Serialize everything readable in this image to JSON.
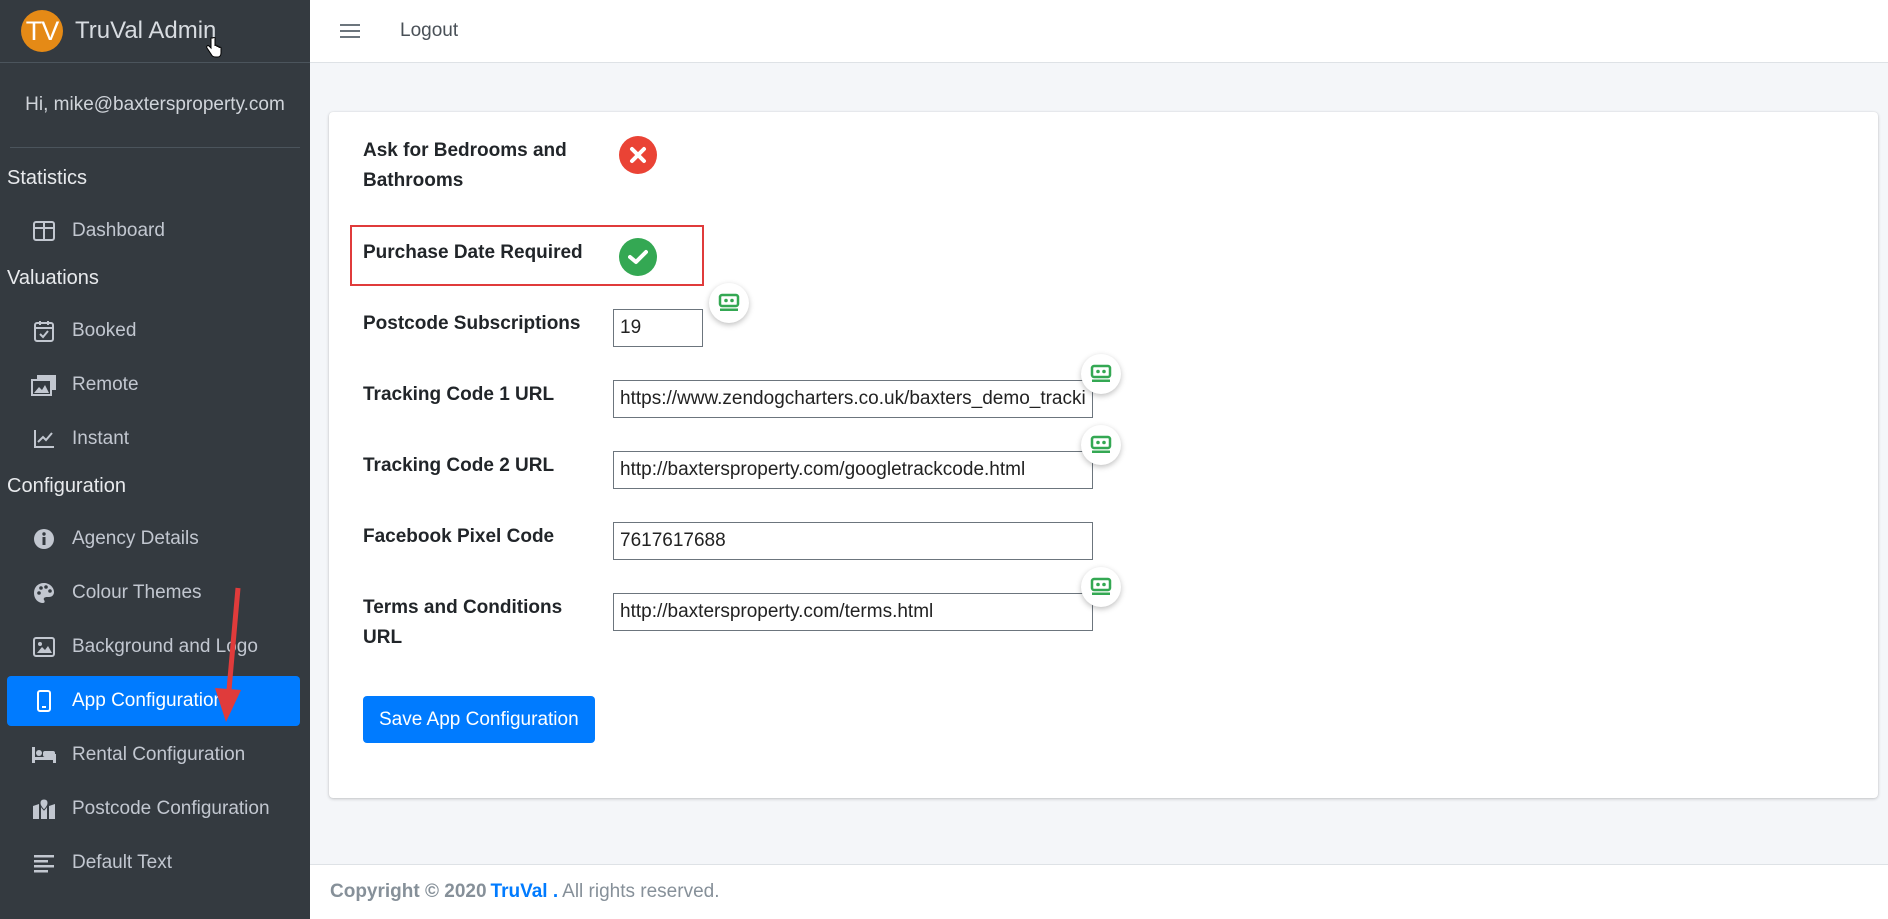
{
  "brand": {
    "logo_text": "TV",
    "name": "TruVal Admin"
  },
  "user": {
    "greeting": "Hi, mike@baxtersproperty.com"
  },
  "nav": {
    "sections": [
      {
        "header": "Statistics",
        "items": [
          {
            "label": "Dashboard",
            "icon": "dashboard-icon"
          }
        ]
      },
      {
        "header": "Valuations",
        "items": [
          {
            "label": "Booked",
            "icon": "calendar-check-icon"
          },
          {
            "label": "Remote",
            "icon": "images-icon"
          },
          {
            "label": "Instant",
            "icon": "chart-line-icon"
          }
        ]
      },
      {
        "header": "Configuration",
        "items": [
          {
            "label": "Agency Details",
            "icon": "info-circle-icon"
          },
          {
            "label": "Colour Themes",
            "icon": "palette-icon"
          },
          {
            "label": "Background and Logo",
            "icon": "image-icon"
          },
          {
            "label": "App Configuration",
            "icon": "mobile-icon",
            "active": true
          },
          {
            "label": "Rental Configuration",
            "icon": "bed-icon"
          },
          {
            "label": "Postcode Configuration",
            "icon": "map-marked-icon"
          },
          {
            "label": "Default Text",
            "icon": "align-left-icon"
          }
        ]
      }
    ]
  },
  "topbar": {
    "logout": "Logout"
  },
  "form": {
    "bedrooms_label": "Ask for Bedrooms and Bathrooms",
    "bedrooms_status": "disabled",
    "purchase_label": "Purchase Date Required",
    "purchase_status": "enabled",
    "postcode_label": "Postcode Subscriptions",
    "postcode_value": "19",
    "tracking1_label": "Tracking Code 1 URL",
    "tracking1_value": "https://www.zendogcharters.co.uk/baxters_demo_tracki",
    "tracking2_label": "Tracking Code 2 URL",
    "tracking2_value": "http://baxtersproperty.com/googletrackcode.html",
    "facebook_label": "Facebook Pixel Code",
    "facebook_value": "7617617688",
    "terms_label": "Terms and Conditions URL",
    "terms_value": "http://baxtersproperty.com/terms.html",
    "save_label": "Save App Configuration"
  },
  "footer": {
    "copyright": "Copyright © 2020",
    "brand": "TruVal .",
    "rest": "All rights reserved."
  },
  "colors": {
    "accent": "#007bff",
    "sidebar": "#343a40",
    "error": "#ea4335",
    "success": "#34a853",
    "highlight": "#e03b3b"
  }
}
